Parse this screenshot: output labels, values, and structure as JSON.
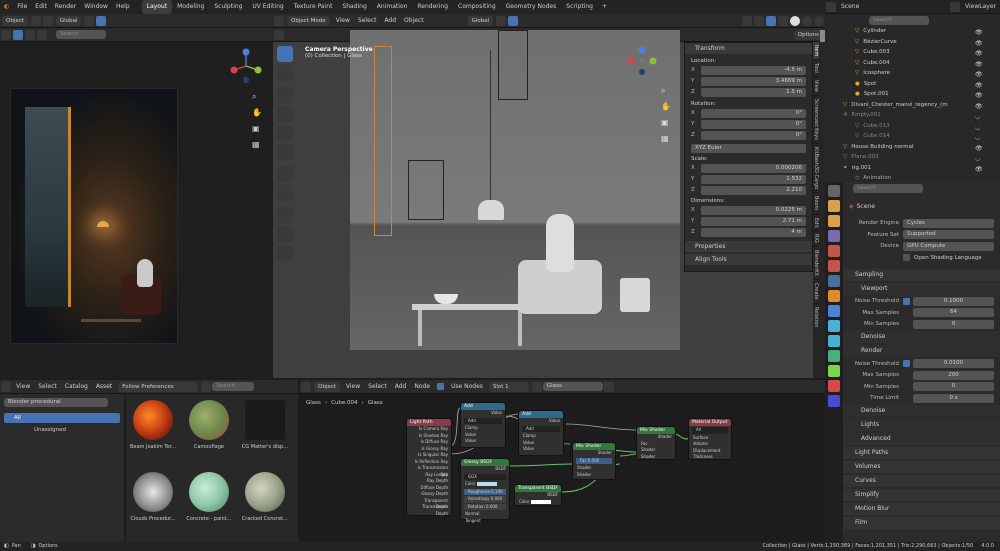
{
  "topbar": {
    "menus": [
      "File",
      "Edit",
      "Render",
      "Window",
      "Help"
    ],
    "workspaces": [
      "Layout",
      "Modeling",
      "Sculpting",
      "UV Editing",
      "Texture Paint",
      "Shading",
      "Animation",
      "Rendering",
      "Compositing",
      "Geometry Nodes",
      "Scripting"
    ],
    "active_workspace": "Layout",
    "scene_label": "Scene",
    "view_layer_label": "ViewLayer"
  },
  "left_viewport": {
    "mode": "Object",
    "orientation": "Global",
    "search_placeholder": "Search"
  },
  "main_viewport": {
    "mode": "Object Mode",
    "menus": [
      "View",
      "Select",
      "Add",
      "Object"
    ],
    "orientation": "Global",
    "camera_title": "Camera Perspective",
    "collection_info": "(0) Collection | Glass",
    "options_label": "Options"
  },
  "n_panel": {
    "transform_title": "Transform",
    "location_label": "Location:",
    "location": [
      {
        "k": "X",
        "v": "-4.5 m"
      },
      {
        "k": "Y",
        "v": "3.4669 m"
      },
      {
        "k": "Z",
        "v": "1.5 m"
      }
    ],
    "rotation_label": "Rotation:",
    "rotation": [
      {
        "k": "X",
        "v": "0°"
      },
      {
        "k": "Y",
        "v": "0°"
      },
      {
        "k": "Z",
        "v": "0°"
      }
    ],
    "euler": "XYZ Euler",
    "scale_label": "Scale:",
    "scale": [
      {
        "k": "X",
        "v": "0.000206"
      },
      {
        "k": "Y",
        "v": "1.532"
      },
      {
        "k": "Z",
        "v": "2.210"
      }
    ],
    "dimensions_label": "Dimensions:",
    "dimensions": [
      {
        "k": "X",
        "v": "0.0225 m"
      },
      {
        "k": "Y",
        "v": "2.71 m"
      },
      {
        "k": "Z",
        "v": "4 m"
      }
    ],
    "properties_label": "Properties",
    "align_tools_label": "Align Tools"
  },
  "side_tabs": [
    "Item",
    "Tool",
    "View",
    "Screencast Keys",
    "KitBash3D Cargo",
    "Boom",
    "Edit",
    "RIG",
    "BlenderKit",
    "Create",
    "Relation"
  ],
  "outliner": {
    "search_placeholder": "Search",
    "items": [
      "Cylinder",
      "BézierCurve",
      "Cube.003",
      "Cube.004",
      "Icosphere",
      "Spot",
      "Spot.001",
      "Divani_Chester_manvi_regency_(m",
      "Empty.001",
      "Cube.013",
      "Cube.014",
      "House Building normal",
      "Plane.003",
      "rig.001",
      "Animation"
    ]
  },
  "properties": {
    "search_placeholder": "Search",
    "scene": "Scene",
    "render_engine_label": "Render Engine",
    "render_engine": "Cycles",
    "feature_set_label": "Feature Set",
    "feature_set": "Supported",
    "device_label": "Device",
    "device": "GPU Compute",
    "osl_label": "Open Shading Language",
    "sampling_label": "Sampling",
    "viewport_label": "Viewport",
    "noise_threshold_label": "Noise Threshold",
    "vp_noise_threshold": "0.1000",
    "max_samples_label": "Max Samples",
    "vp_max_samples": "64",
    "min_samples_label": "Min Samples",
    "vp_min_samples": "0",
    "denoise_label": "Denoise",
    "render_label": "Render",
    "r_noise_threshold": "0.0100",
    "r_max_samples": "200",
    "r_min_samples": "0",
    "time_limit_label": "Time Limit",
    "r_time_limit": "0 s",
    "sections": [
      "Lights",
      "Advanced",
      "Light Paths",
      "Volumes",
      "Curves",
      "Simplify",
      "Motion Blur",
      "Film"
    ]
  },
  "asset_browser": {
    "menus": [
      "View",
      "Select",
      "Catalog",
      "Asset"
    ],
    "preferences": "Follow Preferences",
    "search_placeholder": "Search",
    "library": "Blender procedural",
    "catalog_all": "All",
    "catalog_unassigned": "Unassigned",
    "assets": [
      {
        "name": "Beam Joakim Tor...",
        "color": "#c23a12"
      },
      {
        "name": "Camouflage",
        "color": "#6d8a4d"
      },
      {
        "name": "CG Matter's disp...",
        "color": "#1b1b1b"
      },
      {
        "name": "Clouds Procedur...",
        "color": "#bcbcbc"
      },
      {
        "name": "Concrete - paint...",
        "color": "#8fc7a9"
      },
      {
        "name": "Cracked Concret...",
        "color": "#9aa38b"
      }
    ]
  },
  "node_editor": {
    "mode": "Object",
    "menus": [
      "View",
      "Select",
      "Add",
      "Node"
    ],
    "use_nodes_label": "Use Nodes",
    "slot": "Slot 1",
    "material": "Glass",
    "breadcrumb": [
      "Glass",
      "Cube.004",
      "Glass"
    ],
    "nodes": {
      "light_path": {
        "title": "Light Path",
        "sockets": [
          "Is Camera Ray",
          "Is Shadow Ray",
          "Is Diffuse Ray",
          "Is Glossy Ray",
          "Is Singular Ray",
          "Is Reflection Ray",
          "Is Transmission Ray",
          "Ray Length",
          "Ray Depth",
          "Diffuse Depth",
          "Glossy Depth",
          "Transparent Depth",
          "Transmission Depth"
        ]
      },
      "add1": {
        "title": "Add",
        "sockets": [
          "Value",
          "Add",
          "Clamp",
          "Value",
          "Value"
        ]
      },
      "add2": {
        "title": "Add",
        "sockets": [
          "Value",
          "Add",
          "Clamp",
          "Value",
          "Value"
        ]
      },
      "glossy": {
        "title": "Glossy BSDF",
        "sockets": [
          "BSDF",
          "GGX",
          "Color",
          "Roughness 0.100",
          "Anisotropy 0.000",
          "Rotation 0.000",
          "Normal",
          "Tangent"
        ]
      },
      "transparent": {
        "title": "Transparent BSDF",
        "sockets": [
          "BSDF",
          "Color"
        ]
      },
      "mix1": {
        "title": "Mix Shader",
        "sockets": [
          "Shader",
          "Fac 0.500",
          "Shader",
          "Shader"
        ]
      },
      "mix2": {
        "title": "Mix Shader",
        "sockets": [
          "Shader",
          "Fac",
          "Shader",
          "Shader"
        ]
      },
      "output": {
        "title": "Material Output",
        "sockets": [
          "All",
          "Surface",
          "Volume",
          "Displacement",
          "Thickness"
        ]
      }
    }
  },
  "statusbar": {
    "left1": "Pan",
    "left2": "Options",
    "stats": "Collection | Glass | Verts:1,150,369 | Faces:1,201,351 | Tris:2,290,663 | Objects:1/50",
    "version": "4.0.0"
  },
  "colors": {
    "accent": "#4772b3",
    "header": "#2b2b2b",
    "panel": "#303030"
  }
}
